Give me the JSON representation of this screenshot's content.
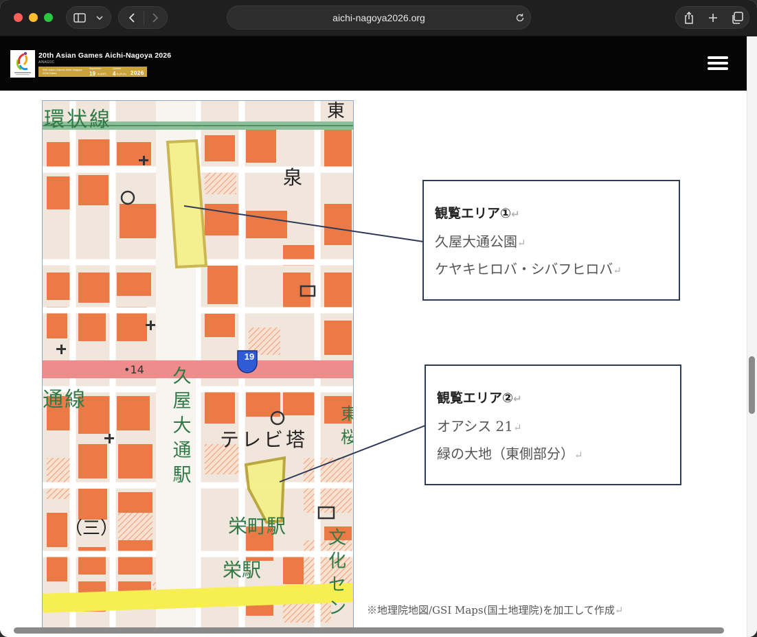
{
  "browser": {
    "url": "aichi-nagoya2026.org",
    "icons": {
      "sidebar": "sidebar-icon",
      "dropdown": "chevron-down-icon",
      "back": "chevron-left-icon",
      "forward": "chevron-right-icon",
      "reload": "reload-icon",
      "share": "share-icon",
      "new_tab": "plus-icon",
      "tabs": "tab-overview-icon"
    }
  },
  "site": {
    "title": "20th Asian Games Aichi-Nagoya 2026",
    "subtitle": "AINAGOC",
    "dates": {
      "event_name": "20th Asian Games Aichi-Nagoya 2026 Dates",
      "start_month": "September",
      "start_day": "19",
      "start_suffix": "th (SAT)",
      "end_month": "October",
      "end_day": "4",
      "end_suffix": "th (SUN)",
      "year": "2026"
    },
    "colors": {
      "header_bg": "#050505",
      "gold": "#c9a23a"
    },
    "menu_icon": "hamburger-menu-icon"
  },
  "map": {
    "labels": {
      "line_top": "環状線",
      "izumi": "泉",
      "route": "19",
      "distance": "•14",
      "line_left": "通線",
      "station_vertical": [
        "久",
        "屋",
        "大",
        "通",
        "駅"
      ],
      "tower": "テレビ塔",
      "sakaemachi": "栄町駅",
      "sakae": "栄駅",
      "san": "（三）",
      "bunka_vertical": [
        "文",
        "化",
        "セ",
        "ン"
      ],
      "top_right": "東",
      "right_mid": "東",
      "right_mid2": "桜"
    }
  },
  "areas": [
    {
      "title": "観覧エリア①",
      "lines": [
        "久屋大通公園",
        "ケヤキヒロバ・シバフヒロバ"
      ]
    },
    {
      "title": "観覧エリア②",
      "lines": [
        "オアシス 21",
        "緑の大地（東側部分）"
      ]
    }
  ],
  "return_mark": "↵",
  "caption": "※地理院地図/GSI Maps(国土地理院)を加工して作成"
}
